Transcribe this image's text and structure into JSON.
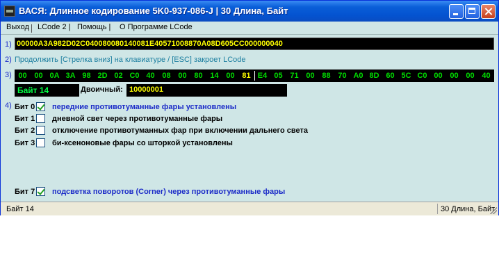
{
  "window": {
    "title": "ВАСЯ: Длинное кодирование  5K0-937-086-J  |  30 Длина, Байт"
  },
  "menu": {
    "items": [
      {
        "label": "Выход"
      },
      {
        "label": "LCode 2 |"
      },
      {
        "label": "Помощь |"
      },
      {
        "label": "О Программе LCode"
      }
    ]
  },
  "section_numbers": {
    "one": "1)",
    "two": "2)",
    "three": "3)",
    "four": "4)"
  },
  "coding": {
    "long_code": "00000A3A982D02C040080080140081E40571008870A08D605CC000000040",
    "hint": "Продолжить [Стрелка вниз] на клавиатуре / [ESC] закроет LCode"
  },
  "bytes": {
    "values": [
      "00",
      "00",
      "0A",
      "3A",
      "98",
      "2D",
      "02",
      "C0",
      "40",
      "08",
      "00",
      "80",
      "14",
      "00",
      "81",
      "E4",
      "05",
      "71",
      "00",
      "88",
      "70",
      "A0",
      "8D",
      "60",
      "5C",
      "C0",
      "00",
      "00",
      "00",
      "40"
    ],
    "selected_index": 14
  },
  "byte_info": {
    "label": "Байт 14",
    "binary_label": "Двоичный:",
    "binary_value": "10000001"
  },
  "bits": [
    {
      "label": "Бит 0",
      "checked": true,
      "text": "передние противотуманные фары установлены"
    },
    {
      "label": "Бит 1",
      "checked": false,
      "text": "дневной свет через противотуманные фары"
    },
    {
      "label": "Бит 2",
      "checked": false,
      "text": "отключение противотуманных фар при включении дальнего света"
    },
    {
      "label": "Бит 3",
      "checked": false,
      "text": "би-ксеноновые фары со шторкой установлены"
    },
    {
      "label": "Бит 7",
      "checked": true,
      "text": "подсветка поворотов (Corner) через противотуманные фары"
    }
  ],
  "status": {
    "left": "Байт 14",
    "right": "30 Длина, Байт"
  },
  "colors": {
    "window_bg": "#cfe6e6",
    "title_bar": "#0a5fd8",
    "code_text": "#ffff00",
    "byte_text": "#00dd00",
    "enabled_text": "#1c2cc8"
  }
}
